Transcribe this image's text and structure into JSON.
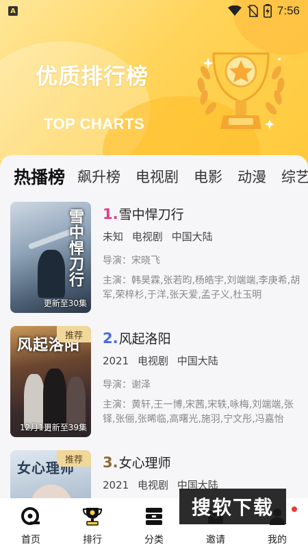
{
  "status": {
    "time": "7:56",
    "app_icon_letter": "A"
  },
  "banner": {
    "title": "优质排行榜",
    "subtitle": "TOP CHARTS"
  },
  "tabs": [
    {
      "label": "热播榜",
      "active": true
    },
    {
      "label": "飙升榜",
      "active": false
    },
    {
      "label": "电视剧",
      "active": false
    },
    {
      "label": "电影",
      "active": false
    },
    {
      "label": "动漫",
      "active": false
    },
    {
      "label": "综艺",
      "active": false
    }
  ],
  "items": [
    {
      "rank": "1.",
      "title": "雪中悍刀行",
      "year": "未知",
      "type": "电视剧",
      "region": "中国大陆",
      "director": "导演：宋晓飞",
      "cast": "主演：韩昊霖,张若昀,杨皓宇,刘端端,李庚希,胡军,荣梓杉,于洋,张天爱,孟子义,杜玉明",
      "badge": "",
      "episodes": "更新至30集",
      "poster_text": "雪中悍刀行",
      "poster_date": ""
    },
    {
      "rank": "2.",
      "title": "风起洛阳",
      "year": "2021",
      "type": "电视剧",
      "region": "中国大陆",
      "director": "导演：谢泽",
      "cast": "主演：黄轩,王一博,宋茜,宋轶,咏梅,刘端端,张铎,张俪,张晞临,高曙光,施羽,宁文彤,冯嘉怡",
      "badge": "推荐",
      "episodes": "更新至39集",
      "poster_text": "风起洛阳",
      "poster_date": "12月1日"
    },
    {
      "rank": "3.",
      "title": "女心理师",
      "year": "2021",
      "type": "电视剧",
      "region": "中国大陆",
      "director": "",
      "cast": "",
      "badge": "推荐",
      "episodes": "",
      "poster_text": "女心理师",
      "poster_date": ""
    }
  ],
  "watermark": "搜软下载",
  "nav": [
    {
      "label": "首页",
      "icon": "home-icon"
    },
    {
      "label": "排行",
      "icon": "trophy-icon"
    },
    {
      "label": "分类",
      "icon": "category-icon"
    },
    {
      "label": "邀请",
      "icon": "invite-icon"
    },
    {
      "label": "我的",
      "icon": "profile-icon"
    }
  ],
  "colors": {
    "banner": "#ffd45a",
    "rank1": "#e23c8a",
    "rank2": "#4a6ae0",
    "rank3": "#8d6a3c",
    "badge": "#f0d79a"
  }
}
